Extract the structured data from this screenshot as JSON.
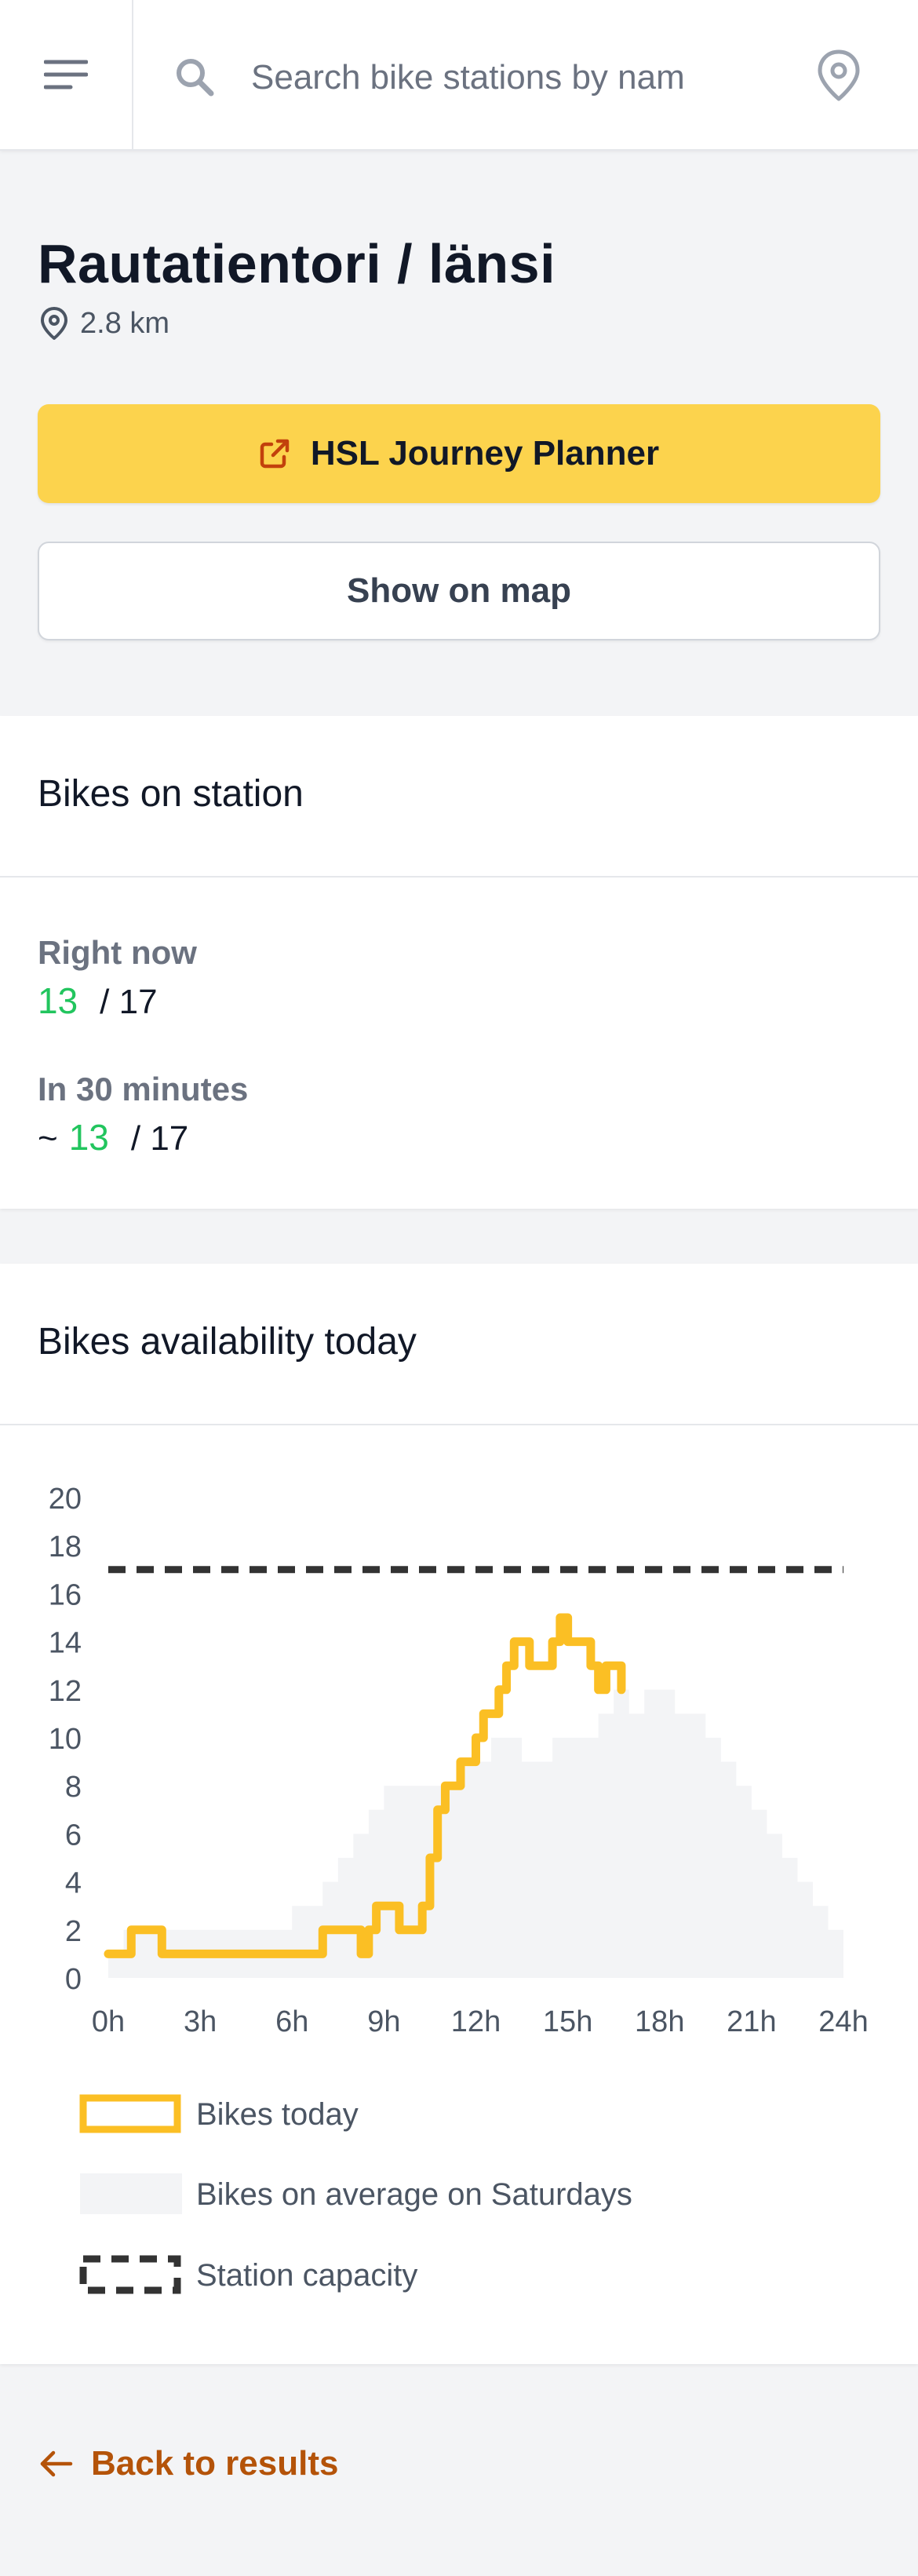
{
  "search": {
    "placeholder": "Search bike stations by nam",
    "icon": "search-icon"
  },
  "header": {
    "menu_icon": "hamburger-menu-icon",
    "location_icon": "map-pin-icon"
  },
  "station": {
    "name": "Rautatientori / länsi",
    "distance": "2.8 km"
  },
  "actions": {
    "journey_planner": "HSL Journey Planner",
    "show_on_map": "Show on map"
  },
  "bikes_card": {
    "title": "Bikes on station",
    "right_now_label": "Right now",
    "right_now_value": "13",
    "right_now_capacity": "/ 17",
    "in30_label": "In 30 minutes",
    "in30_prefix": "~",
    "in30_value": "13",
    "in30_capacity": "/ 17"
  },
  "availability_card": {
    "title": "Bikes availability today"
  },
  "colors": {
    "accent_yellow": "#fcd34d",
    "today_line": "#fbbf24",
    "available_green": "#22c55e",
    "link_brown": "#b45309",
    "average_fill": "#f3f4f6",
    "capacity_line": "#333333"
  },
  "chart_data": {
    "type": "line",
    "xlim": [
      0,
      24
    ],
    "ylim": [
      0,
      20
    ],
    "xticks": [
      "0h",
      "3h",
      "6h",
      "9h",
      "12h",
      "15h",
      "18h",
      "21h",
      "24h"
    ],
    "yticks": [
      "0",
      "2",
      "4",
      "6",
      "8",
      "10",
      "12",
      "14",
      "16",
      "18",
      "20"
    ],
    "grid": false,
    "legend_position": "bottom",
    "series": [
      {
        "name": "Bikes today",
        "style": "step-line",
        "color": "#fbbf24",
        "x": [
          0,
          0.5,
          0.75,
          1.5,
          1.75,
          2,
          3,
          4,
          5,
          6,
          6.5,
          7,
          7.5,
          8,
          8.25,
          8.5,
          8.75,
          9.25,
          9.5,
          10,
          10.25,
          10.5,
          10.75,
          11,
          11.25,
          11.5,
          11.75,
          12,
          12.25,
          12.5,
          12.75,
          13,
          13.25,
          13.5,
          13.75,
          14,
          14.25,
          14.5,
          14.75,
          15,
          15.25,
          15.5,
          15.75,
          16,
          16.25,
          16.5,
          16.75
        ],
        "y": [
          1,
          1,
          2,
          2,
          1,
          1,
          1,
          1,
          1,
          1,
          1,
          2,
          2,
          2,
          1,
          2,
          3,
          3,
          2,
          2,
          3,
          5,
          7,
          8,
          8,
          9,
          9,
          10,
          11,
          11,
          12,
          13,
          14,
          14,
          13,
          13,
          13,
          14,
          15,
          14,
          14,
          14,
          13,
          12,
          13,
          13,
          12
        ]
      },
      {
        "name": "Bikes on average on Saturdays",
        "style": "area",
        "color": "#f3f4f6",
        "x": [
          0,
          0.5,
          1,
          1.5,
          2,
          2.5,
          3,
          3.5,
          4,
          4.5,
          5,
          5.5,
          6,
          6.5,
          7,
          7.5,
          8,
          8.5,
          9,
          9.5,
          10,
          10.5,
          11,
          11.5,
          12,
          12.5,
          13,
          13.5,
          14,
          14.5,
          15,
          15.5,
          16,
          16.5,
          17,
          17.5,
          18,
          18.5,
          19,
          19.5,
          20,
          20.5,
          21,
          21.5,
          22,
          22.5,
          23,
          23.5,
          24
        ],
        "y": [
          1,
          2,
          2,
          2,
          2,
          2,
          2,
          2,
          2,
          2,
          2,
          2,
          3,
          3,
          4,
          5,
          6,
          7,
          8,
          8,
          8,
          8,
          8,
          9,
          9,
          10,
          10,
          9,
          9,
          10,
          10,
          10,
          11,
          12,
          11,
          12,
          12,
          11,
          11,
          10,
          9,
          8,
          7,
          6,
          5,
          4,
          3,
          2,
          0
        ]
      },
      {
        "name": "Station capacity",
        "style": "dashed",
        "color": "#333333",
        "x": [
          0,
          24
        ],
        "y": [
          17,
          17
        ]
      }
    ]
  }
}
